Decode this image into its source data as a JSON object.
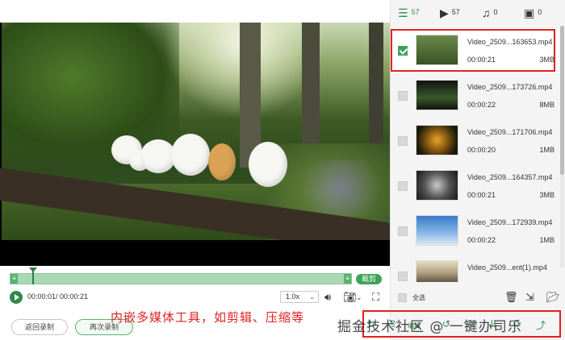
{
  "player": {
    "time_display": "00:00:01/ 00:00:21",
    "speed": "1.0x",
    "cut_label": "裁剪",
    "progress": 0.05
  },
  "buttons": {
    "back_record": "返回录制",
    "record_again": "再次录制"
  },
  "annotation": "内嵌多媒体工具，如剪辑、压缩等",
  "watermark": "掘金技术社区 @ 一键办司乐",
  "tabs": [
    {
      "icon": "list-icon",
      "count": "57",
      "active": true
    },
    {
      "icon": "video-icon",
      "count": "57",
      "active": false
    },
    {
      "icon": "music-icon",
      "count": "0",
      "active": false
    },
    {
      "icon": "image-icon",
      "count": "0",
      "active": false
    }
  ],
  "files": [
    {
      "name": "Video_2509...163653.mp4",
      "duration": "00:00:21",
      "size": "3MB",
      "checked": true
    },
    {
      "name": "Video_2509...173726.mp4",
      "duration": "00:00:22",
      "size": "8MB",
      "checked": false
    },
    {
      "name": "Video_2509...171706.mp4",
      "duration": "00:00:20",
      "size": "1MB",
      "checked": false
    },
    {
      "name": "Video_2509...164357.mp4",
      "duration": "00:00:21",
      "size": "3MB",
      "checked": false
    },
    {
      "name": "Video_2509...172939.mp4",
      "duration": "00:00:22",
      "size": "1MB",
      "checked": false
    },
    {
      "name": "Video_2509...ent(1).mp4",
      "duration": "",
      "size": "",
      "checked": false
    }
  ],
  "select_all_label": "全选",
  "toolbar_label": "编辑",
  "colors": {
    "accent": "#2e8b4a",
    "highlight": "#e02020",
    "track": "#a9d9b4"
  }
}
